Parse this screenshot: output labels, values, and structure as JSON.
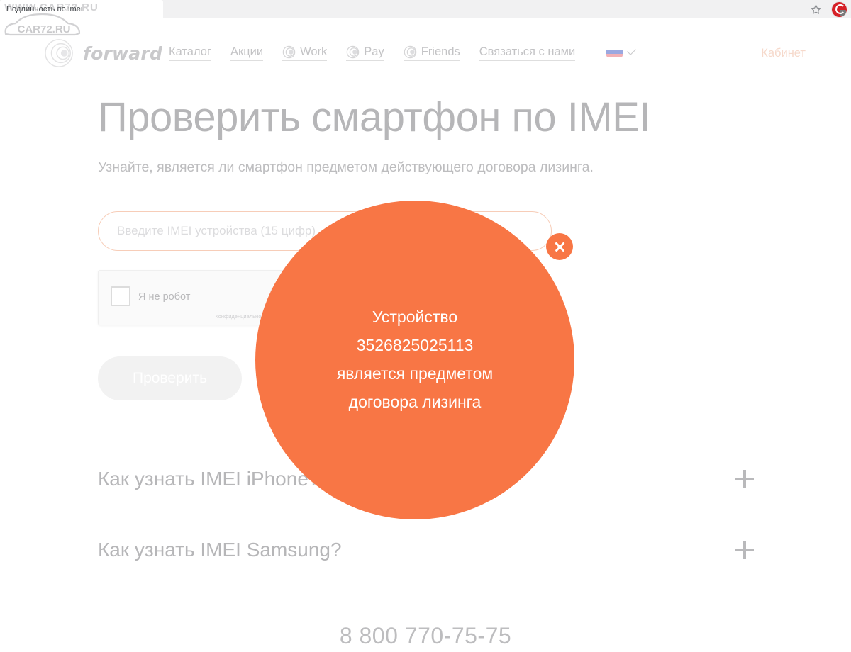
{
  "browser": {
    "tab_title": "Подлинность по imei",
    "bookmark_icon": "star-icon",
    "extension_icon": "extension-icon"
  },
  "watermark": {
    "top_text": "WWW.CAR72.RU",
    "logo_text": "CAR72.RU"
  },
  "header": {
    "brand_name": "forward",
    "brand_mark_icon": "forward-swirl-logo-icon",
    "nav": [
      {
        "label": "Каталог",
        "icon": null
      },
      {
        "label": "Акции",
        "icon": null
      },
      {
        "label": "Work",
        "icon": "swirl-icon"
      },
      {
        "label": "Pay",
        "icon": "swirl-icon"
      },
      {
        "label": "Friends",
        "icon": "swirl-icon"
      },
      {
        "label": "Связаться с нами",
        "icon": null
      }
    ],
    "language": {
      "flag": "russia-flag-icon",
      "chevron": "chevron-down-icon"
    },
    "account_label": "Кабинет",
    "account_color": "#f6d9cb"
  },
  "hero": {
    "title": "Проверить смартфон по IMEI",
    "subtitle": "Узнайте, является ли смартфон предметом действующего договора лизинга."
  },
  "form": {
    "imei_placeholder": "Введите IMEI устройства (15 цифр)",
    "imei_value": "",
    "recaptcha": {
      "label": "Я не робот",
      "fine_print": "Конфиденциальность - Условия",
      "checked": false,
      "logo_icon": "recaptcha-logo-icon"
    },
    "submit_label": "Проверить"
  },
  "modal": {
    "accent_color": "#f87645",
    "message": "Устройство\n3526825025113\nявляется предметом\nдоговора лизинга",
    "device_imei": "3526825025113",
    "close_icon": "close-icon"
  },
  "faq": {
    "items": [
      {
        "question": "Как узнать IMEI iPhone?",
        "expand_icon": "plus-icon"
      },
      {
        "question": "Как узнать IMEI Samsung?",
        "expand_icon": "plus-icon"
      }
    ]
  },
  "footer": {
    "phone": "8 800 770-75-75"
  }
}
